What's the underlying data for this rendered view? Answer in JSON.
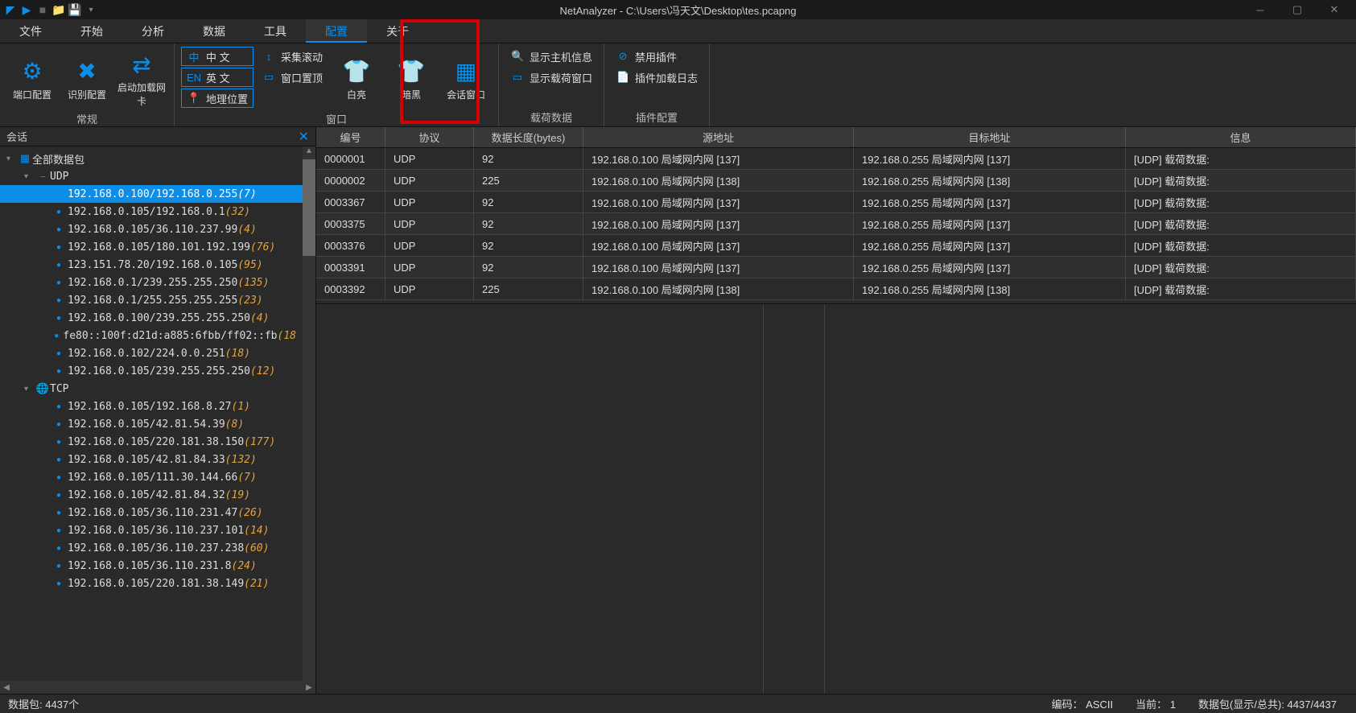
{
  "title": "NetAnalyzer - C:\\Users\\冯天文\\Desktop\\tes.pcapng",
  "menubar": [
    "文件",
    "开始",
    "分析",
    "数据",
    "工具",
    "配置",
    "关于"
  ],
  "active_tab": 5,
  "ribbon": {
    "groups": [
      {
        "label": "常规",
        "big": [
          {
            "icon": "⚙",
            "text": "端口配置"
          },
          {
            "icon": "✖",
            "text": "识别配置"
          },
          {
            "icon": "⇄",
            "text": "启动加载网卡"
          }
        ]
      },
      {
        "label": "窗口",
        "small_cols": [
          [
            {
              "icon": "中",
              "text": "中 文",
              "boxed": true
            },
            {
              "icon": "EN",
              "text": "英 文",
              "boxed": true
            },
            {
              "icon": "📍",
              "text": "地理位置",
              "boxed": true
            }
          ],
          [
            {
              "icon": "↕",
              "text": "采集滚动"
            },
            {
              "icon": "▭",
              "text": "窗口置顶"
            }
          ]
        ],
        "big": [
          {
            "icon": "👕",
            "text": "白亮"
          },
          {
            "icon": "👕",
            "text": "暗黑",
            "accent": true
          },
          {
            "icon": "▦",
            "text": "会话窗口",
            "highlight": true
          }
        ]
      },
      {
        "label": "载荷数据",
        "small_cols": [
          [
            {
              "icon": "🔍",
              "text": "显示主机信息"
            },
            {
              "icon": "▭",
              "text": "显示载荷窗口"
            }
          ]
        ]
      },
      {
        "label": "插件配置",
        "small_cols": [
          [
            {
              "icon": "⊘",
              "text": "禁用插件"
            },
            {
              "icon": "📄",
              "text": "插件加载日志"
            }
          ]
        ]
      }
    ]
  },
  "sidepanel": {
    "title": "会话",
    "root": "全部数据包",
    "protocols": [
      {
        "name": "UDP",
        "items": [
          {
            "label": "192.168.0.100/192.168.0.255",
            "count": "(7)",
            "selected": true
          },
          {
            "label": "192.168.0.105/192.168.0.1",
            "count": "(32)"
          },
          {
            "label": "192.168.0.105/36.110.237.99",
            "count": "(4)"
          },
          {
            "label": "192.168.0.105/180.101.192.199",
            "count": "(76)"
          },
          {
            "label": "123.151.78.20/192.168.0.105",
            "count": "(95)"
          },
          {
            "label": "192.168.0.1/239.255.255.250",
            "count": "(135)"
          },
          {
            "label": "192.168.0.1/255.255.255.255",
            "count": "(23)"
          },
          {
            "label": "192.168.0.100/239.255.255.250",
            "count": "(4)"
          },
          {
            "label": "fe80::100f:d21d:a885:6fbb/ff02::fb",
            "count": "(18"
          },
          {
            "label": "192.168.0.102/224.0.0.251",
            "count": "(18)"
          },
          {
            "label": "192.168.0.105/239.255.255.250",
            "count": "(12)"
          }
        ]
      },
      {
        "name": "TCP",
        "items": [
          {
            "label": "192.168.0.105/192.168.8.27",
            "count": "(1)"
          },
          {
            "label": "192.168.0.105/42.81.54.39",
            "count": "(8)"
          },
          {
            "label": "192.168.0.105/220.181.38.150",
            "count": "(177)"
          },
          {
            "label": "192.168.0.105/42.81.84.33",
            "count": "(132)"
          },
          {
            "label": "192.168.0.105/111.30.144.66",
            "count": "(7)"
          },
          {
            "label": "192.168.0.105/42.81.84.32",
            "count": "(19)"
          },
          {
            "label": "192.168.0.105/36.110.231.47",
            "count": "(26)"
          },
          {
            "label": "192.168.0.105/36.110.237.101",
            "count": "(14)"
          },
          {
            "label": "192.168.0.105/36.110.237.238",
            "count": "(60)"
          },
          {
            "label": "192.168.0.105/36.110.231.8",
            "count": "(24)"
          },
          {
            "label": "192.168.0.105/220.181.38.149",
            "count": "(21)"
          }
        ]
      }
    ]
  },
  "grid": {
    "headers": [
      "编号",
      "协议",
      "数据长度(bytes)",
      "源地址",
      "目标地址",
      "信息"
    ],
    "rows": [
      {
        "idx": "0000001",
        "proto": "UDP",
        "len": "92",
        "src": "192.168.0.100 局域网内网 [137]",
        "dst": "192.168.0.255 局域网内网 [137]",
        "info": "[UDP] 载荷数据:"
      },
      {
        "idx": "0000002",
        "proto": "UDP",
        "len": "225",
        "src": "192.168.0.100 局域网内网 [138]",
        "dst": "192.168.0.255 局域网内网 [138]",
        "info": "[UDP] 载荷数据:"
      },
      {
        "idx": "0003367",
        "proto": "UDP",
        "len": "92",
        "src": "192.168.0.100 局域网内网 [137]",
        "dst": "192.168.0.255 局域网内网 [137]",
        "info": "[UDP] 载荷数据:"
      },
      {
        "idx": "0003375",
        "proto": "UDP",
        "len": "92",
        "src": "192.168.0.100 局域网内网 [137]",
        "dst": "192.168.0.255 局域网内网 [137]",
        "info": "[UDP] 载荷数据:"
      },
      {
        "idx": "0003376",
        "proto": "UDP",
        "len": "92",
        "src": "192.168.0.100 局域网内网 [137]",
        "dst": "192.168.0.255 局域网内网 [137]",
        "info": "[UDP] 载荷数据:"
      },
      {
        "idx": "0003391",
        "proto": "UDP",
        "len": "92",
        "src": "192.168.0.100 局域网内网 [137]",
        "dst": "192.168.0.255 局域网内网 [137]",
        "info": "[UDP] 载荷数据:"
      },
      {
        "idx": "0003392",
        "proto": "UDP",
        "len": "225",
        "src": "192.168.0.100 局域网内网 [138]",
        "dst": "192.168.0.255 局域网内网 [138]",
        "info": "[UDP] 载荷数据:"
      }
    ]
  },
  "statusbar": {
    "packets": "数据包:  4437个",
    "encoding_label": "编码：",
    "encoding_value": "ASCII",
    "current_label": "当前：",
    "current_value": "1",
    "display": "数据包(显示/总共):  4437/4437"
  }
}
